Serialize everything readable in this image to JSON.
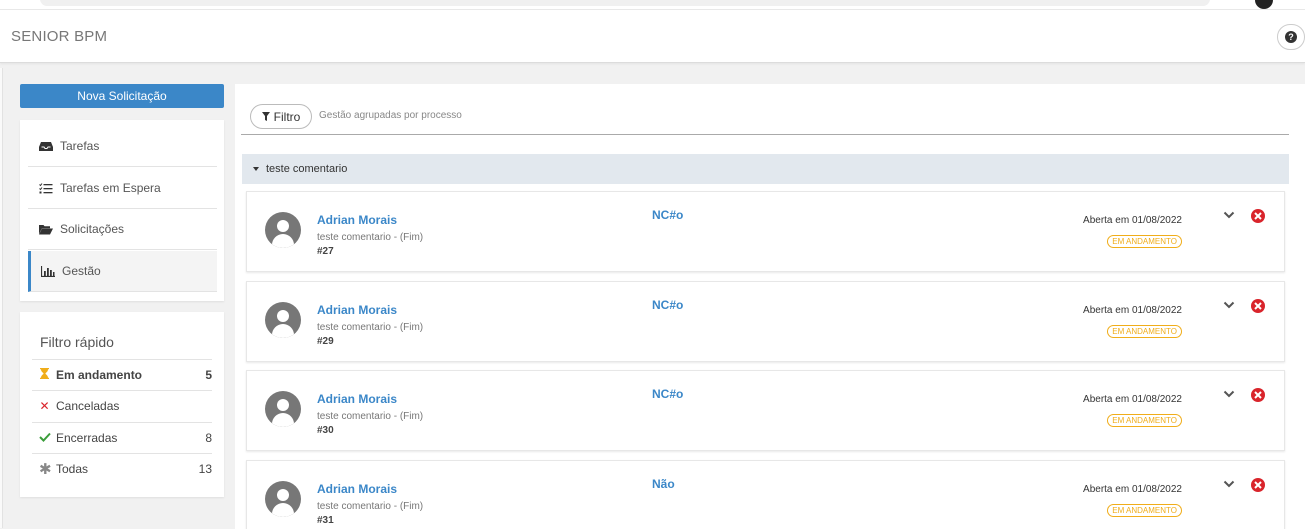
{
  "app": {
    "title": "SENIOR BPM"
  },
  "sidebar": {
    "new_request": "Nova Solicitação",
    "nav": [
      {
        "label": "Tarefas",
        "icon": "inbox-icon"
      },
      {
        "label": "Tarefas em Espera",
        "icon": "list-check-icon"
      },
      {
        "label": "Solicitações",
        "icon": "folder-open-icon"
      },
      {
        "label": "Gestão",
        "icon": "bar-chart-icon",
        "active": true
      }
    ]
  },
  "quick_filter": {
    "title": "Filtro rápido",
    "rows": [
      {
        "label": "Em andamento",
        "count": "5",
        "icon": "hourglass-icon",
        "icon_color": "#f0ad1a",
        "selected": true
      },
      {
        "label": "Canceladas",
        "count": "",
        "icon": "x-icon",
        "icon_color": "#d9242b"
      },
      {
        "label": "Encerradas",
        "count": "8",
        "icon": "check-icon",
        "icon_color": "#3a9d3a"
      },
      {
        "label": "Todas",
        "count": "13",
        "icon": "asterisk-icon",
        "icon_color": "#888888"
      }
    ]
  },
  "main": {
    "filter_button": "Filtro",
    "filter_note": "Gestão agrupadas por processo",
    "group": {
      "label": "teste comentario"
    },
    "cards": [
      {
        "name": "Adrian Morais",
        "subtitle": "teste comentario - (Fim)",
        "number": "#27",
        "label": "NC#o",
        "date": "Aberta em 01/08/2022",
        "badge": "EM ANDAMENTO"
      },
      {
        "name": "Adrian Morais",
        "subtitle": "teste comentario - (Fim)",
        "number": "#29",
        "label": "NC#o",
        "date": "Aberta em 01/08/2022",
        "badge": "EM ANDAMENTO"
      },
      {
        "name": "Adrian Morais",
        "subtitle": "teste comentario - (Fim)",
        "number": "#30",
        "label": "NC#o",
        "date": "Aberta em 01/08/2022",
        "badge": "EM ANDAMENTO"
      },
      {
        "name": "Adrian Morais",
        "subtitle": "teste comentario - (Fim)",
        "number": "#31",
        "label": "Não",
        "date": "Aberta em 01/08/2022",
        "badge": "EM ANDAMENTO"
      }
    ]
  },
  "colors": {
    "accent": "#3b87c8",
    "warning": "#f0ad1a",
    "danger": "#d9242b",
    "success": "#3a9d3a"
  }
}
